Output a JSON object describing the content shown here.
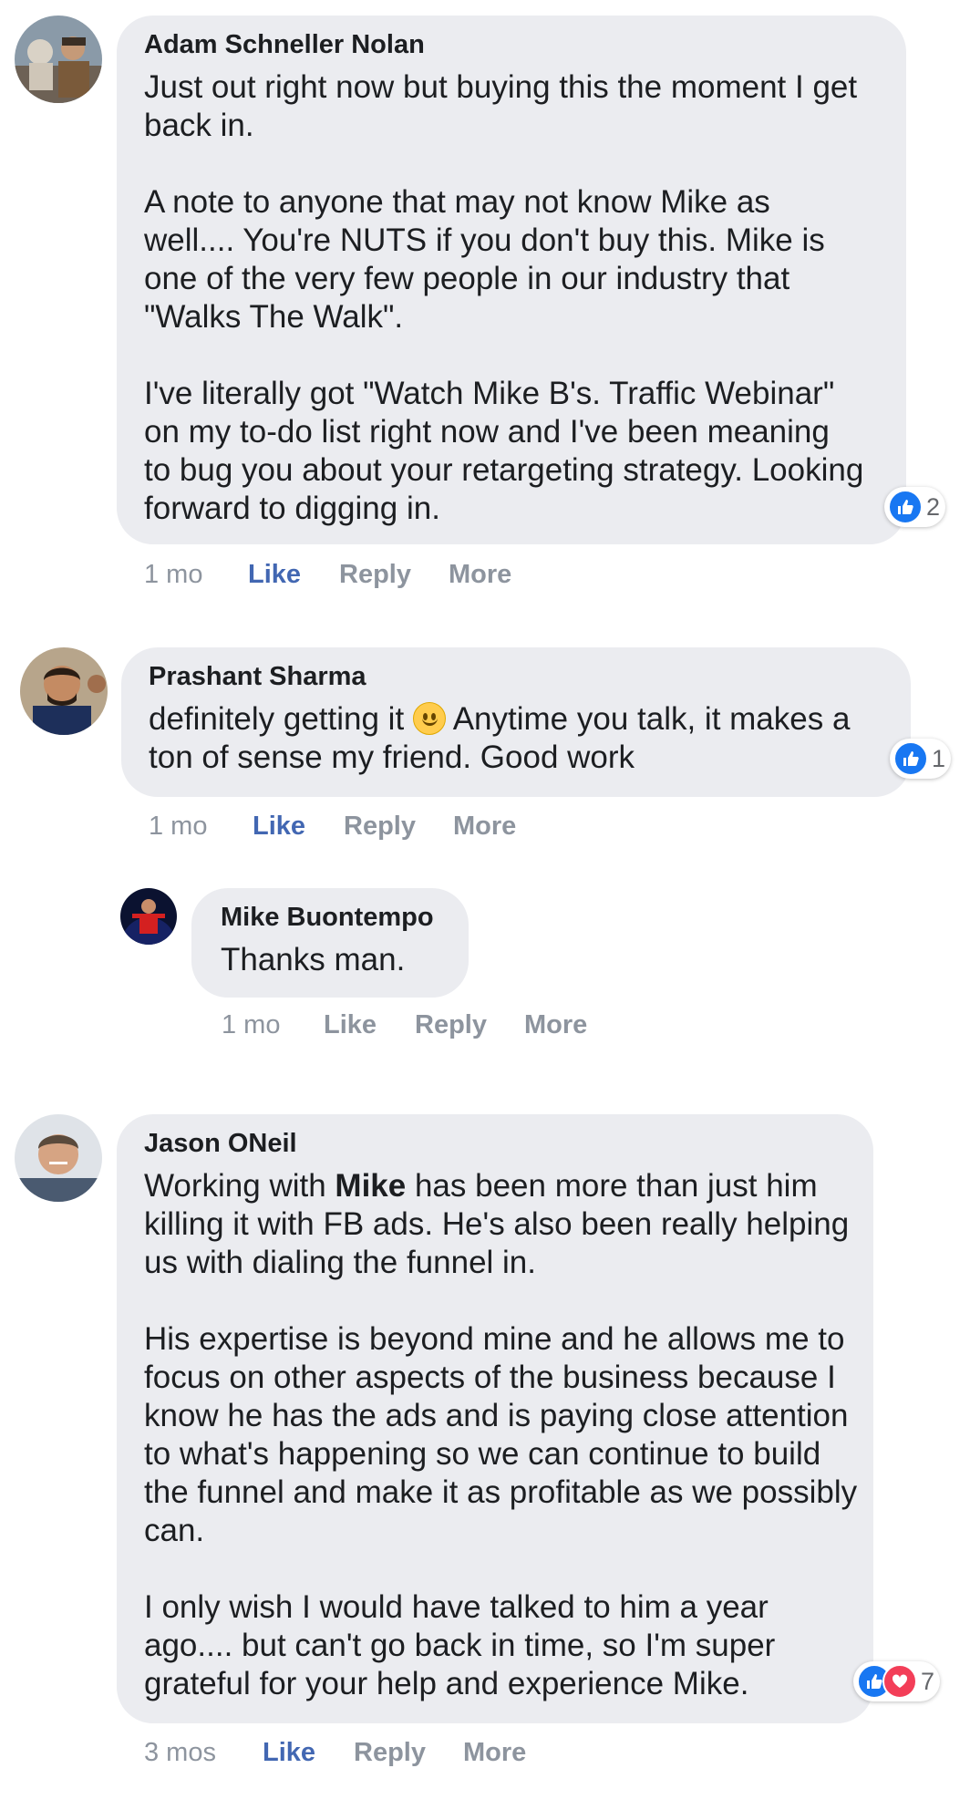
{
  "colors": {
    "bubble": "#ebecf0",
    "like_blue": "#4267b2",
    "meta_gray": "#8d949e",
    "love_red": "#f33e58"
  },
  "comments": [
    {
      "author": "Adam Schneller Nolan",
      "paragraphs": [
        "Just out right now but buying this the moment I get back in.",
        "A note to anyone that may not know Mike as well.... You're NUTS if you don't buy this. Mike is one of the very few people in our industry that \"Walks The Walk\".",
        "I've literally got \"Watch Mike B's. Traffic Webinar\" on my to-do list right now and I've been meaning to bug you about your retargeting strategy. Looking forward to digging in."
      ],
      "reaction_count": "2",
      "reaction_icons": [
        "like-icon"
      ],
      "time": "1 mo",
      "like": "Like",
      "reply": "Reply",
      "more": "More"
    },
    {
      "author": "Prashant Sharma",
      "text_before_emoji": "definitely getting it",
      "emoji": "slightly-smiling-face-emoji",
      "text_after_emoji": " Anytime you talk, it makes a ton of sense my friend. Good work",
      "reaction_count": "1",
      "reaction_icons": [
        "like-icon"
      ],
      "time": "1 mo",
      "like": "Like",
      "reply": "Reply",
      "more": "More",
      "reply_comment": {
        "author": "Mike Buontempo",
        "text": "Thanks man.",
        "time": "1 mo",
        "like": "Like",
        "reply": "Reply",
        "more": "More"
      }
    },
    {
      "author": "Jason ONeil",
      "p1_before_bold": "Working with ",
      "p1_bold": "Mike",
      "p1_after_bold": " has been more than just him killing it with FB ads. He's also been really helping us with dialing the funnel in.",
      "paragraphs": [
        "His expertise is beyond mine and he allows me to focus on other aspects of the business because I know he has the ads and is paying close attention to what's happening so we can continue to build the funnel and make it as profitable as we possibly can.",
        "I only wish I would have talked to him a year ago.... but can't go back in time, so I'm super grateful for your help and experience Mike."
      ],
      "reaction_count": "7",
      "reaction_icons": [
        "like-icon",
        "love-icon"
      ],
      "time": "3 mos",
      "like": "Like",
      "reply": "Reply",
      "more": "More"
    }
  ]
}
